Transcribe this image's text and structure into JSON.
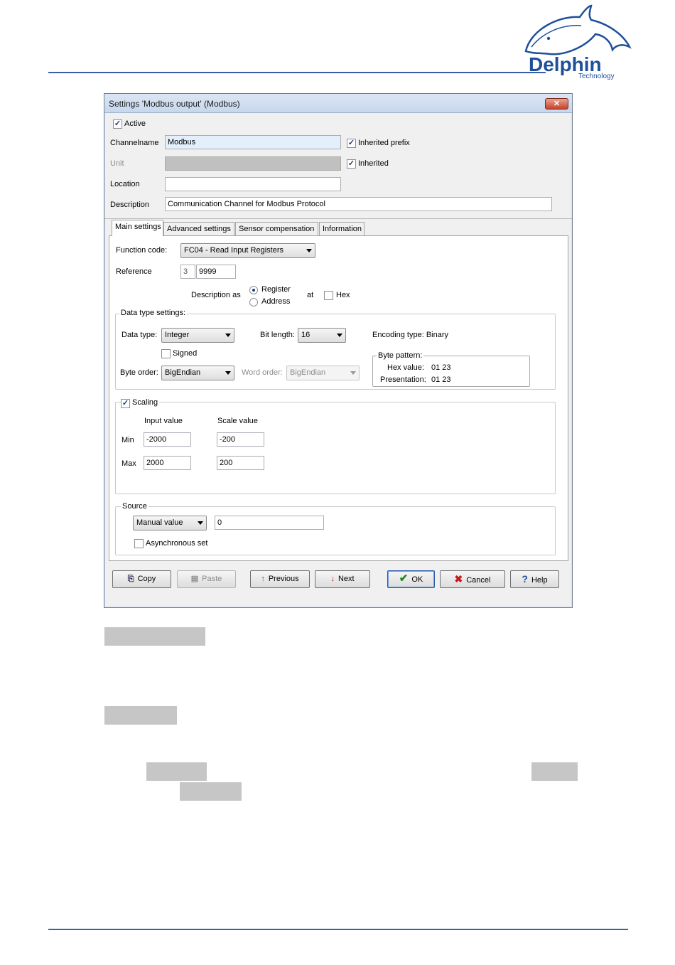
{
  "brand": {
    "logo_text": "Delphin",
    "logo_sub": "Technology",
    "color": "#1d4f9a"
  },
  "dialog": {
    "title": "Settings 'Modbus output' (Modbus)",
    "close_symbol": "✕",
    "active_label": "Active",
    "active_checked": true,
    "channelname_label": "Channelname",
    "channelname_value": "Modbus",
    "inherited_prefix_label": "Inherited prefix",
    "unit_label": "Unit",
    "unit_value": "",
    "inherited_label": "Inherited",
    "location_label": "Location",
    "location_value": "",
    "description_label": "Description",
    "description_value": "Communication Channel for Modbus Protocol",
    "tabs": [
      {
        "label": "Main settings"
      },
      {
        "label": "Advanced settings"
      },
      {
        "label": "Sensor compensation"
      },
      {
        "label": "Information"
      }
    ],
    "main": {
      "function_code_label": "Function code:",
      "function_code_value": "FC04 - Read Input Registers",
      "reference_label": "Reference",
      "reference_prefix": "3",
      "reference_value": "9999",
      "description_as_label": "Description as",
      "register_label": "Register",
      "address_label": "Address",
      "at_label": "at",
      "hex_label": "Hex",
      "data_type_group": "Data type settings:",
      "data_type_label": "Data type:",
      "data_type_value": "Integer",
      "bit_length_label": "Bit length:",
      "bit_length_value": "16",
      "encoding_label": "Encoding type: Binary",
      "signed_label": "Signed",
      "byte_order_label": "Byte order:",
      "byte_order_value": "BigEndian",
      "word_order_label": "Word order:",
      "word_order_value": "BigEndian",
      "byte_pattern_group": "Byte pattern:",
      "hex_value_label": "Hex value:",
      "hex_value": "01 23",
      "presentation_label": "Presentation:",
      "presentation_value": "01 23",
      "scaling_label": "Scaling",
      "input_value_header": "Input value",
      "scale_value_header": "Scale value",
      "min_label": "Min",
      "max_label": "Max",
      "min_input": "-2000",
      "min_scale": "-200",
      "max_input": "2000",
      "max_scale": "200",
      "source_group": "Source",
      "source_value": "Manual value",
      "source_manual": "0",
      "async_label": "Asynchronous set"
    },
    "buttons": {
      "copy": "Copy",
      "paste": "Paste",
      "previous": "Previous",
      "next": "Next",
      "ok": "OK",
      "cancel": "Cancel",
      "help": "Help"
    }
  }
}
